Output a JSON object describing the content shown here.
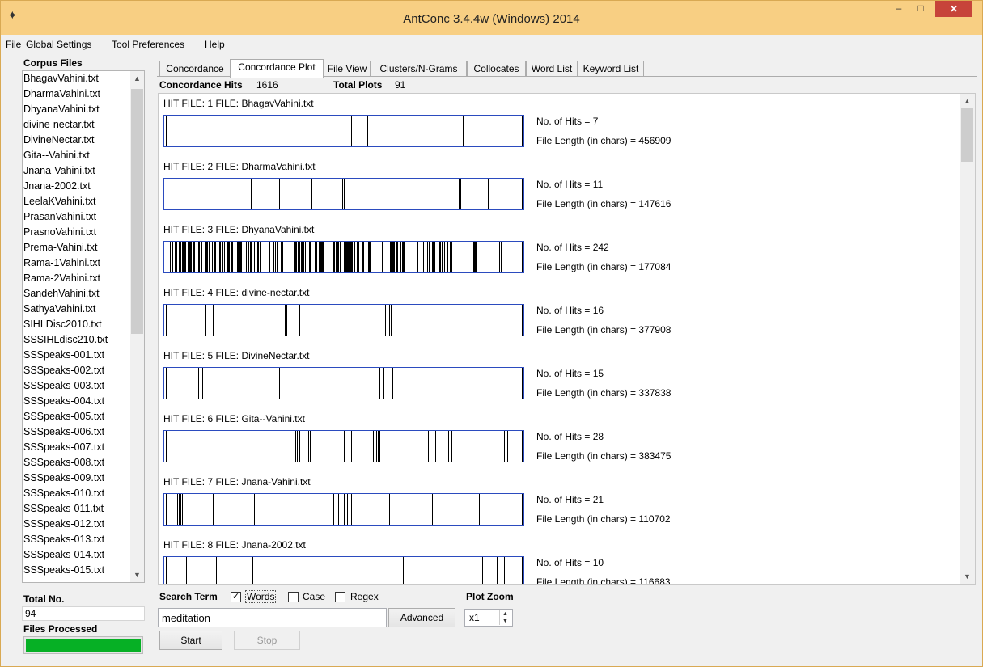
{
  "window": {
    "title": "AntConc 3.4.4w (Windows) 2014"
  },
  "menu": [
    "File",
    "Global Settings",
    "Tool Preferences",
    "Help"
  ],
  "left_panel": {
    "corpus_files_label": "Corpus Files",
    "files": [
      "BhagavVahini.txt",
      "DharmaVahini.txt",
      "DhyanaVahini.txt",
      "divine-nectar.txt",
      "DivineNectar.txt",
      "Gita--Vahini.txt",
      "Jnana-Vahini.txt",
      "Jnana-2002.txt",
      "LeelaKVahini.txt",
      "PrasanVahini.txt",
      "PrasnoVahini.txt",
      "Prema-Vahini.txt",
      "Rama-1Vahini.txt",
      "Rama-2Vahini.txt",
      "SandehVahini.txt",
      "SathyaVahini.txt",
      "SIHLDisc2010.txt",
      "SSSIHLdisc210.txt",
      "SSSpeaks-001.txt",
      "SSSpeaks-002.txt",
      "SSSpeaks-003.txt",
      "SSSpeaks-004.txt",
      "SSSpeaks-005.txt",
      "SSSpeaks-006.txt",
      "SSSpeaks-007.txt",
      "SSSpeaks-008.txt",
      "SSSpeaks-009.txt",
      "SSSpeaks-010.txt",
      "SSSpeaks-011.txt",
      "SSSpeaks-012.txt",
      "SSSpeaks-013.txt",
      "SSSpeaks-014.txt",
      "SSSpeaks-015.txt"
    ],
    "total_no_label": "Total No.",
    "total_no_value": "94",
    "files_processed_label": "Files Processed",
    "progress": 1.0,
    "progress_color": "#06b025"
  },
  "tabs": [
    "Concordance",
    "Concordance Plot",
    "File View",
    "Clusters/N-Grams",
    "Collocates",
    "Word List",
    "Keyword List"
  ],
  "active_tab": "Concordance Plot",
  "summary": {
    "hits_label": "Concordance Hits",
    "hits_value": "1616",
    "plots_label": "Total Plots",
    "plots_value": "91"
  },
  "plots": [
    {
      "title": "HIT FILE: 1   FILE: BhagavVahini.txt",
      "hits_text": "No. of Hits = 7",
      "length_text": "File Length (in chars) = 456909",
      "hits": [
        0.005,
        0.52,
        0.565,
        0.575,
        0.68,
        0.83,
        0.995
      ]
    },
    {
      "title": "HIT FILE: 2   FILE: DharmaVahini.txt",
      "hits_text": "No. of Hits = 11",
      "length_text": "File Length (in chars) = 147616",
      "hits": [
        0.24,
        0.29,
        0.32,
        0.41,
        0.49,
        0.495,
        0.5,
        0.82,
        0.825,
        0.9,
        0.995
      ]
    },
    {
      "title": "HIT FILE: 3   FILE: DhyanaVahini.txt",
      "hits_text": "No. of Hits = 242",
      "length_text": "File Length (in chars) = 177084",
      "hits": []
    },
    {
      "title": "HIT FILE: 4   FILE: divine-nectar.txt",
      "hits_text": "No. of Hits = 16",
      "length_text": "File Length (in chars) = 377908",
      "hits": [
        0.005,
        0.115,
        0.135,
        0.335,
        0.34,
        0.375,
        0.615,
        0.625,
        0.63,
        0.655,
        0.995
      ]
    },
    {
      "title": "HIT FILE: 5   FILE: DivineNectar.txt",
      "hits_text": "No. of Hits = 15",
      "length_text": "File Length (in chars) = 337838",
      "hits": [
        0.005,
        0.095,
        0.105,
        0.315,
        0.32,
        0.36,
        0.6,
        0.61,
        0.635,
        0.995
      ]
    },
    {
      "title": "HIT FILE: 6   FILE: Gita--Vahini.txt",
      "hits_text": "No. of Hits = 28",
      "length_text": "File Length (in chars) = 383475",
      "hits": [
        0.005,
        0.195,
        0.365,
        0.37,
        0.375,
        0.4,
        0.405,
        0.5,
        0.52,
        0.58,
        0.585,
        0.59,
        0.595,
        0.6,
        0.735,
        0.75,
        0.755,
        0.79,
        0.8,
        0.945,
        0.95,
        0.955,
        0.995
      ]
    },
    {
      "title": "HIT FILE: 7   FILE: Jnana-Vahini.txt",
      "hits_text": "No. of Hits = 21",
      "length_text": "File Length (in chars) = 110702",
      "hits": [
        0.005,
        0.035,
        0.04,
        0.045,
        0.05,
        0.135,
        0.25,
        0.315,
        0.47,
        0.485,
        0.5,
        0.51,
        0.52,
        0.625,
        0.67,
        0.745,
        0.875,
        0.995
      ]
    },
    {
      "title": "HIT FILE: 8   FILE: Jnana-2002.txt",
      "hits_text": "No. of Hits = 10",
      "length_text": "File Length (in chars) = 116683",
      "hits": [
        0.005,
        0.06,
        0.145,
        0.245,
        0.455,
        0.665,
        0.885,
        0.925,
        0.945,
        0.995
      ]
    }
  ],
  "controls": {
    "search_term_label": "Search Term",
    "words_label": "Words",
    "words_checked": true,
    "case_label": "Case",
    "case_checked": false,
    "regex_label": "Regex",
    "regex_checked": false,
    "search_value": "meditation",
    "advanced_label": "Advanced",
    "plot_zoom_label": "Plot Zoom",
    "zoom_value": "x1",
    "start_label": "Start",
    "stop_label": "Stop"
  }
}
